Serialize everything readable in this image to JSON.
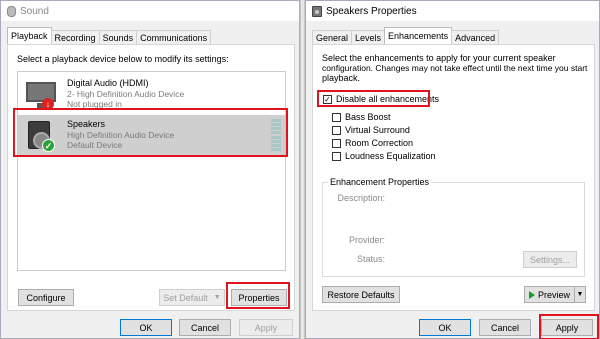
{
  "left_window": {
    "title": "Sound",
    "tabs": [
      "Playback",
      "Recording",
      "Sounds",
      "Communications"
    ],
    "instruction": "Select a playback device below to modify its settings:",
    "devices": [
      {
        "name": "Digital Audio (HDMI)",
        "description": "2- High Definition Audio Device",
        "status": "Not plugged in"
      },
      {
        "name": "Speakers",
        "description": "High Definition Audio Device",
        "status": "Default Device"
      }
    ],
    "buttons": {
      "configure": "Configure",
      "set_default": "Set Default",
      "properties": "Properties",
      "ok": "OK",
      "cancel": "Cancel",
      "apply": "Apply"
    }
  },
  "right_window": {
    "title": "Speakers Properties",
    "tabs": [
      "General",
      "Levels",
      "Enhancements",
      "Advanced"
    ],
    "instruction_line1": "Select the enhancements to apply for your current speaker",
    "instruction_line2": "configuration. Changes may not take effect until the next time you start",
    "instruction_line3": "playback.",
    "disable_all": {
      "label": "Disable all enhancements",
      "checked": true
    },
    "enhancements": [
      {
        "label": "Bass Boost",
        "checked": false
      },
      {
        "label": "Virtual Surround",
        "checked": false
      },
      {
        "label": "Room Correction",
        "checked": false
      },
      {
        "label": "Loudness Equalization",
        "checked": false
      }
    ],
    "properties_group": {
      "legend": "Enhancement Properties",
      "description_label": "Description:",
      "provider_label": "Provider:",
      "status_label": "Status:",
      "settings_button": "Settings..."
    },
    "buttons": {
      "restore_defaults": "Restore Defaults",
      "preview": "Preview",
      "ok": "OK",
      "cancel": "Cancel",
      "apply": "Apply"
    }
  },
  "colors": {
    "highlight": "#e0141e",
    "selected_row": "#cfcfcf",
    "default_check": "#2aa33a",
    "unplugged_badge": "#d22222"
  }
}
